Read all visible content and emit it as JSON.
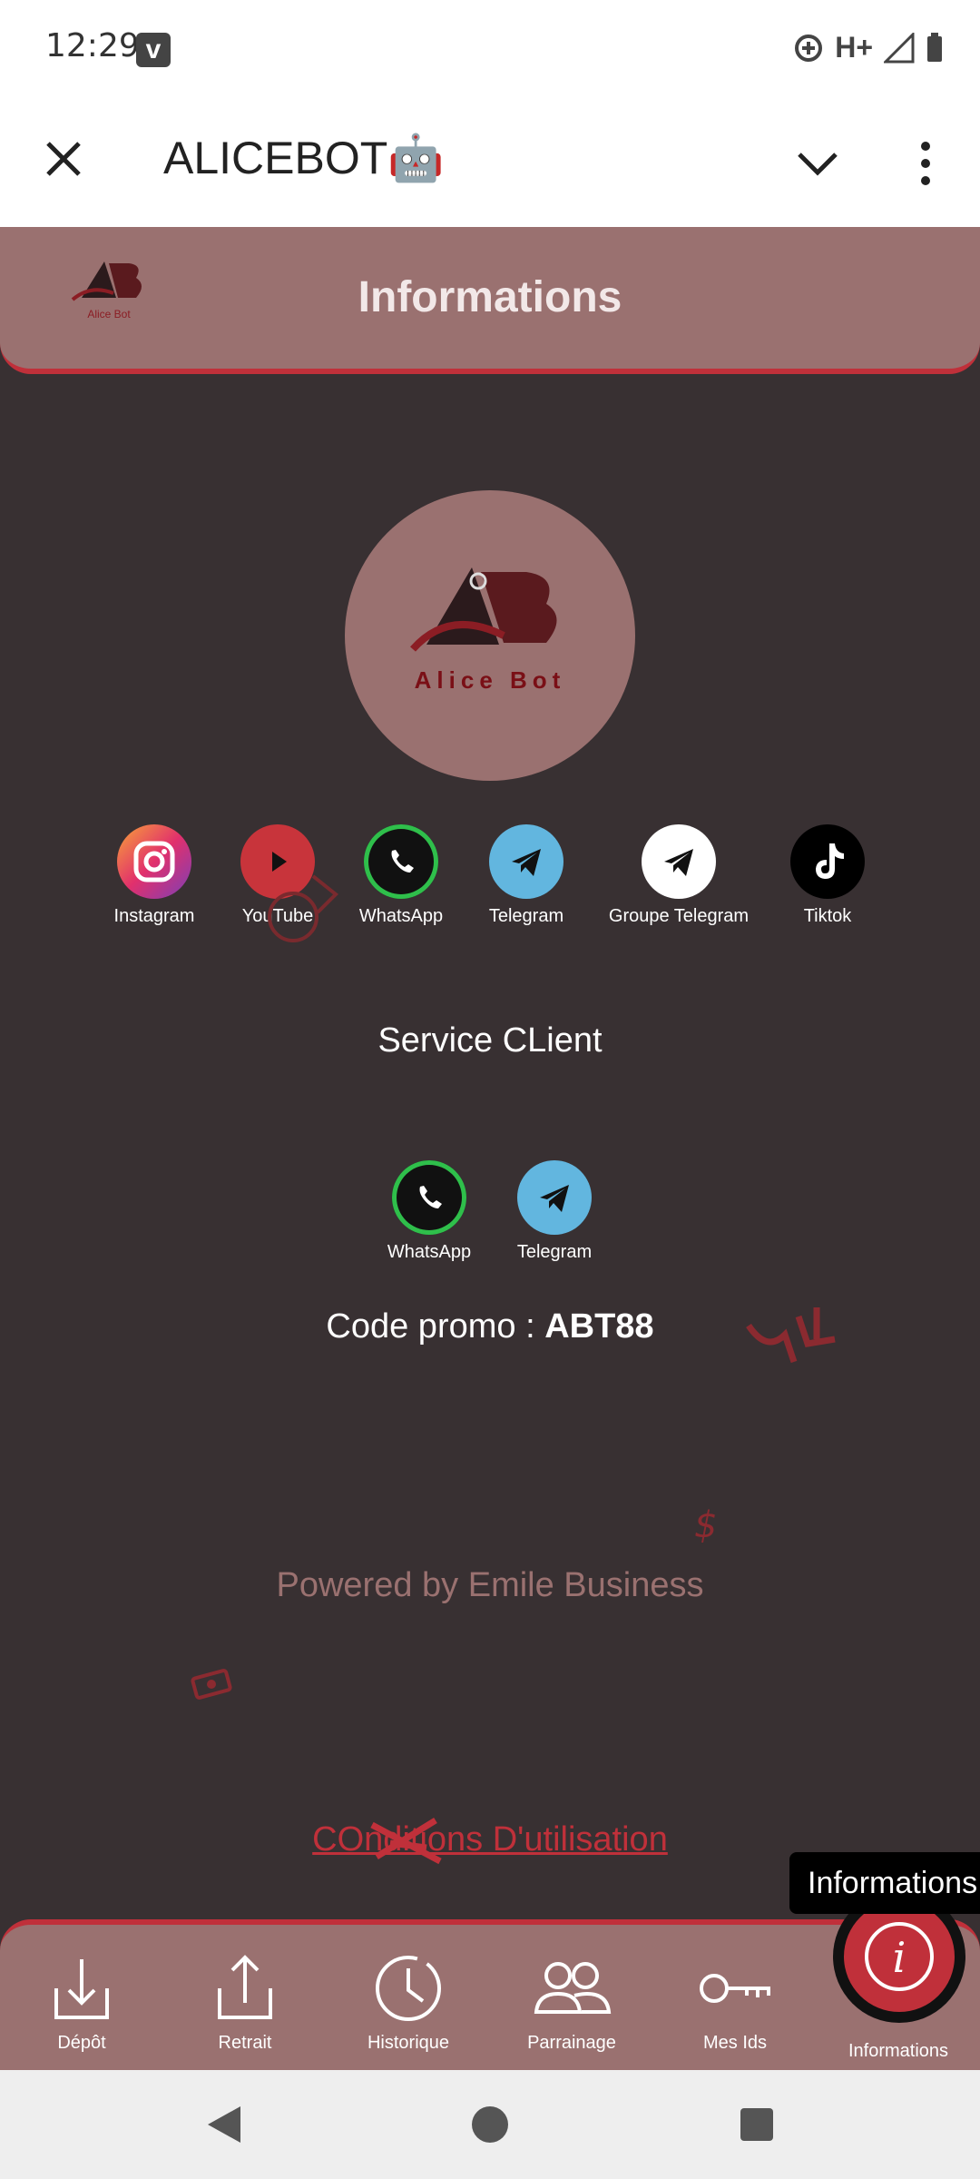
{
  "status_bar": {
    "time": "12:29",
    "network": "H+"
  },
  "app_bar": {
    "title": "ALICEBOT🤖"
  },
  "header": {
    "title": "Informations",
    "logo_text": "Alice Bot"
  },
  "logo": {
    "text": "Alice Bot"
  },
  "social_links": [
    {
      "label": "Instagram",
      "icon": "instagram-icon"
    },
    {
      "label": "YouTube",
      "icon": "youtube-icon"
    },
    {
      "label": "WhatsApp",
      "icon": "whatsapp-icon"
    },
    {
      "label": "Telegram",
      "icon": "telegram-icon"
    },
    {
      "label": "Groupe Telegram",
      "icon": "telegram-icon"
    },
    {
      "label": "Tiktok",
      "icon": "tiktok-icon"
    }
  ],
  "service_client": {
    "title": "Service CLient",
    "links": [
      {
        "label": "WhatsApp",
        "icon": "whatsapp-icon"
      },
      {
        "label": "Telegram",
        "icon": "telegram-icon"
      }
    ]
  },
  "promo": {
    "label": "Code promo : ",
    "code": "ABT88"
  },
  "powered_by": "Powered by Emile Business",
  "conditions_link": "COnditions D'utilisation",
  "tooltip": "Informations",
  "bottom_nav": [
    {
      "label": "Dépôt",
      "icon": "download-tray-icon"
    },
    {
      "label": "Retrait",
      "icon": "upload-tray-icon"
    },
    {
      "label": "Historique",
      "icon": "clock-icon"
    },
    {
      "label": "Parrainage",
      "icon": "people-icon"
    },
    {
      "label": "Mes Ids",
      "icon": "key-icon"
    },
    {
      "label": "Informations",
      "icon": "info-icon"
    }
  ],
  "colors": {
    "accent": "#c0303a",
    "surface": "#9a7170",
    "background": "#383032"
  }
}
